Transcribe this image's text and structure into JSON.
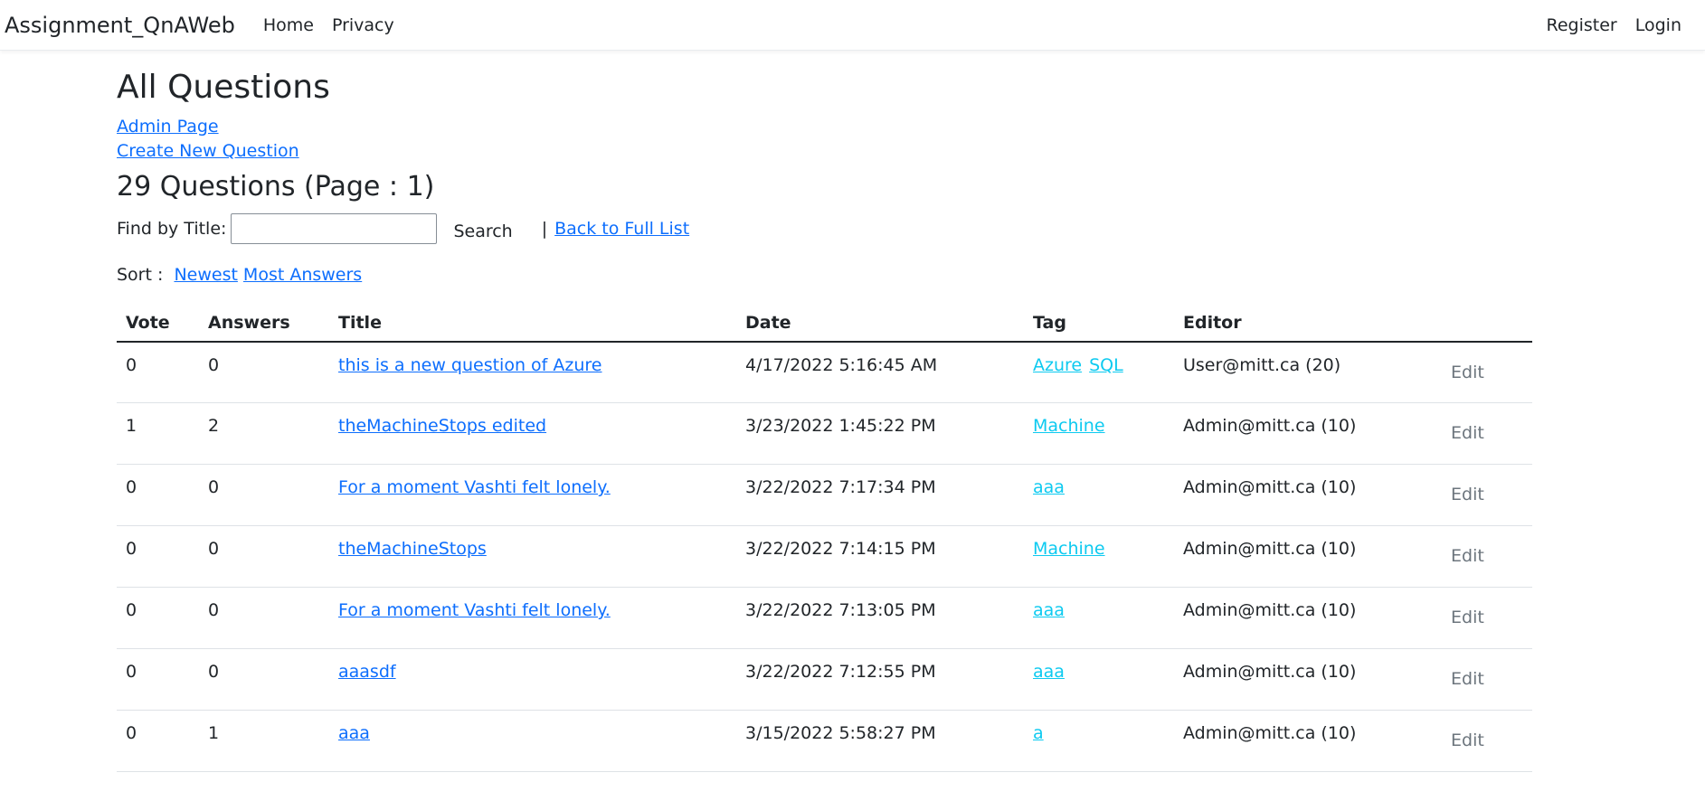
{
  "navbar": {
    "brand": "Assignment_QnAWeb",
    "links": [
      "Home",
      "Privacy"
    ],
    "right_links": [
      "Register",
      "Login"
    ]
  },
  "page": {
    "title": "All Questions",
    "admin_link": "Admin Page",
    "create_link": "Create New Question",
    "count_heading": "29 Questions (Page : 1)"
  },
  "search": {
    "label": "Find by Title:",
    "value": "",
    "button": "Search",
    "separator": "|",
    "back_link": "Back to Full List"
  },
  "sort": {
    "label": "Sort :",
    "newest": "Newest",
    "most_answers": "Most Answers"
  },
  "table": {
    "headers": [
      "Vote",
      "Answers",
      "Title",
      "Date",
      "Tag",
      "Editor",
      ""
    ],
    "rows": [
      {
        "vote": "0",
        "answers": "0",
        "title": "this is a new question of Azure",
        "date": "4/17/2022 5:16:45 AM",
        "tags": [
          "Azure",
          "SQL"
        ],
        "editor": "User@mitt.ca (20)",
        "edit": "Edit"
      },
      {
        "vote": "1",
        "answers": "2",
        "title": "theMachineStops edited",
        "date": "3/23/2022 1:45:22 PM",
        "tags": [
          "Machine"
        ],
        "editor": "Admin@mitt.ca (10)",
        "edit": "Edit"
      },
      {
        "vote": "0",
        "answers": "0",
        "title": "For a moment Vashti felt lonely.",
        "date": "3/22/2022 7:17:34 PM",
        "tags": [
          "aaa"
        ],
        "editor": "Admin@mitt.ca (10)",
        "edit": "Edit"
      },
      {
        "vote": "0",
        "answers": "0",
        "title": "theMachineStops",
        "date": "3/22/2022 7:14:15 PM",
        "tags": [
          "Machine"
        ],
        "editor": "Admin@mitt.ca (10)",
        "edit": "Edit"
      },
      {
        "vote": "0",
        "answers": "0",
        "title": "For a moment Vashti felt lonely.",
        "date": "3/22/2022 7:13:05 PM",
        "tags": [
          "aaa"
        ],
        "editor": "Admin@mitt.ca (10)",
        "edit": "Edit"
      },
      {
        "vote": "0",
        "answers": "0",
        "title": "aaasdf",
        "date": "3/22/2022 7:12:55 PM",
        "tags": [
          "aaa"
        ],
        "editor": "Admin@mitt.ca (10)",
        "edit": "Edit"
      },
      {
        "vote": "0",
        "answers": "1",
        "title": "aaa",
        "date": "3/15/2022 5:58:27 PM",
        "tags": [
          "a"
        ],
        "editor": "Admin@mitt.ca (10)",
        "edit": "Edit"
      }
    ]
  }
}
